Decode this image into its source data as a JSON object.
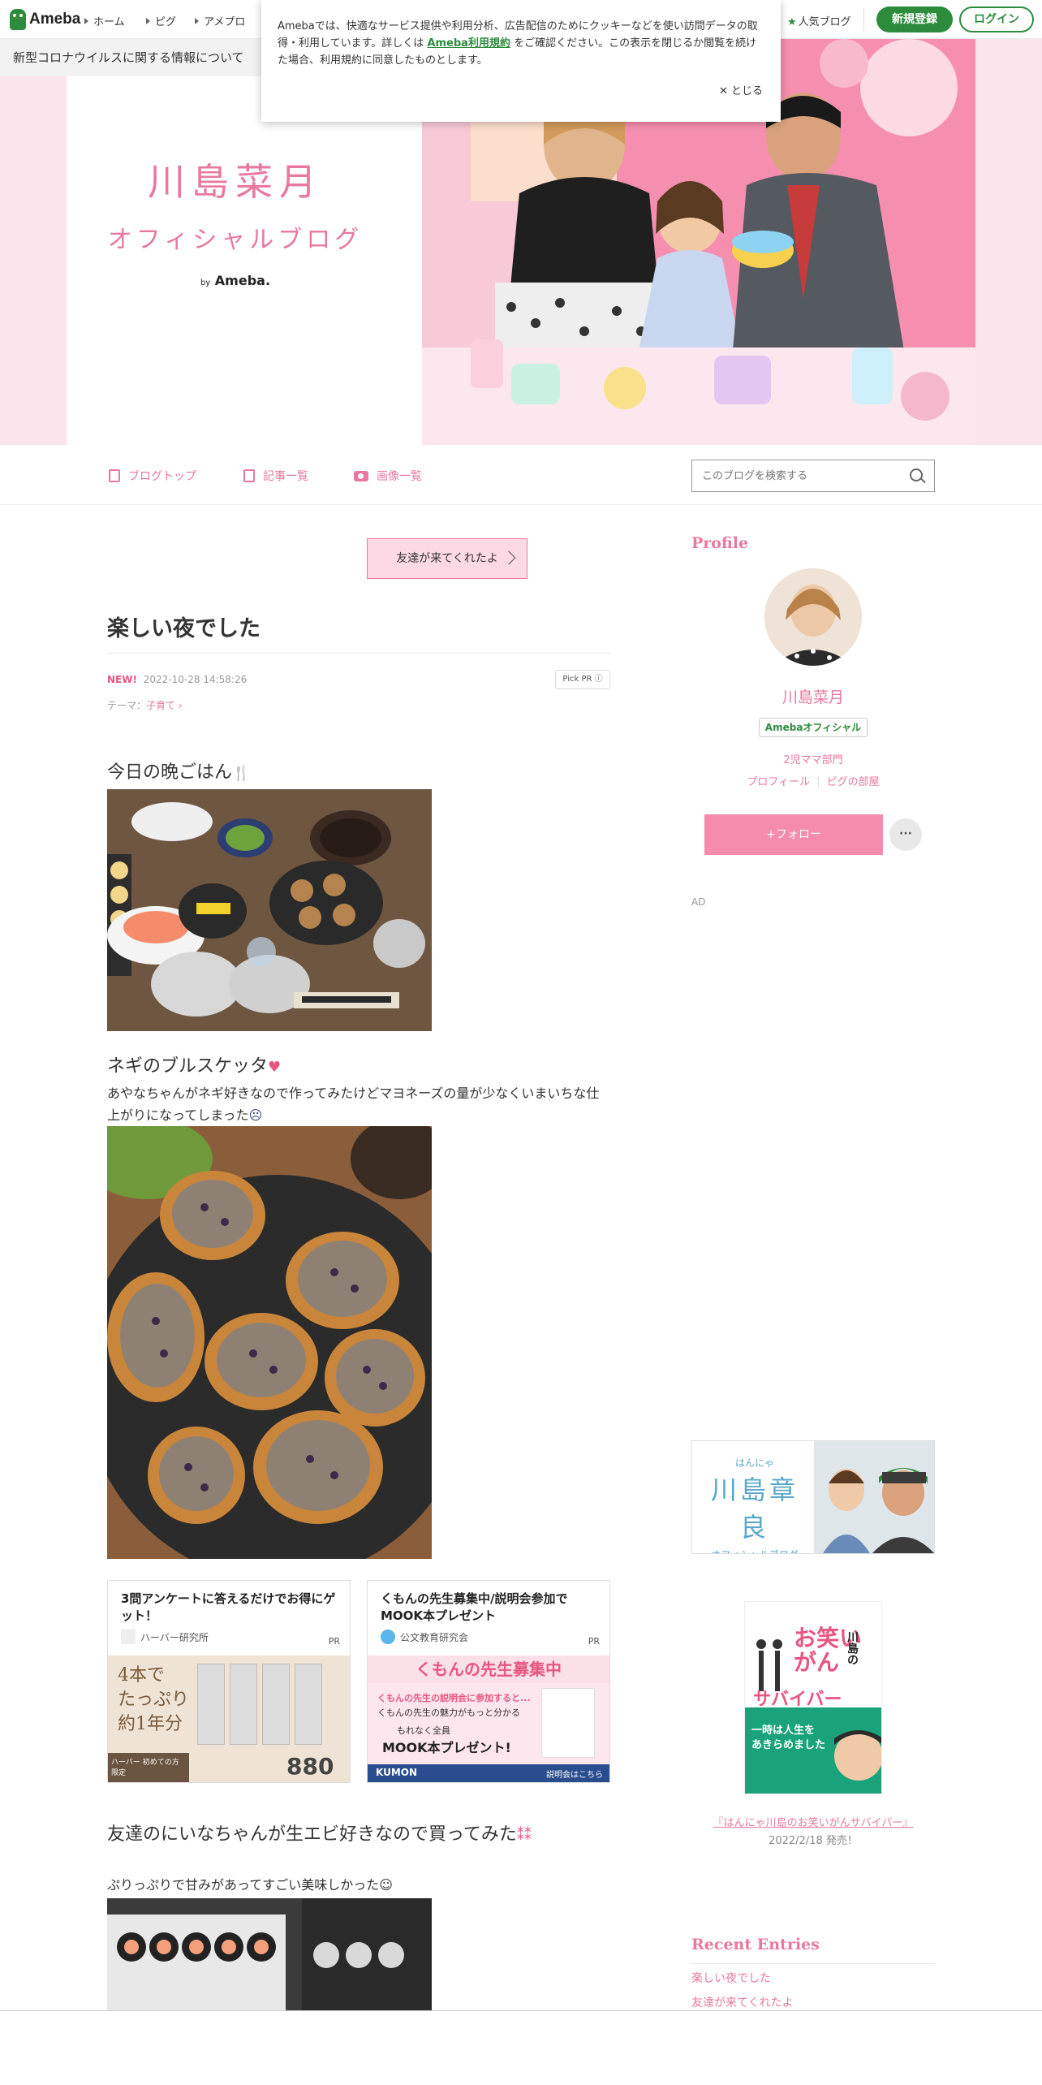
{
  "topbar": {
    "logo": "Ameba",
    "nav": [
      "ホーム",
      "ピグ",
      "アメプロ"
    ],
    "popular": "人気ブログ",
    "signup": "新規登録",
    "login": "ログイン"
  },
  "covid_banner": "新型コロナウイルスに関する情報について",
  "cookie": {
    "text_before": "Amebaでは、快適なサービス提供や利用分析、広告配信のためにクッキーなどを使い訪問データの取得・利用しています。詳しくは",
    "link": "Ameba利用規約",
    "text_after": "をご確認ください。この表示を閉じるか閲覧を続けた場合、利用規約に同意したものとします。",
    "close": "とじる"
  },
  "header": {
    "title_line1": "川島菜月",
    "title_line2": "オフィシャルブログ",
    "by": "by",
    "by_brand": "Ameba."
  },
  "blog_nav": {
    "items": [
      "ブログトップ",
      "記事一覧",
      "画像一覧"
    ],
    "search_placeholder": "このブログを検索する"
  },
  "entry": {
    "prev_button": "友達が来てくれたよ",
    "title": "楽しい夜でした",
    "new_badge": "NEW!",
    "date": "2022-10-28 14:58:26",
    "pick_pr": "Pick PR ⓘ",
    "theme_label": "テーマ：",
    "theme": "子育て",
    "p1": "今日の晩ごはん",
    "p2": "ネギのブルスケッタ",
    "p3": "あやなちゃんがネギ好きなので作ってみたけどマヨネーズの量が少なくいまいちな仕上がりになってしまった",
    "p4": "友達のにいなちゃんが生エビ好きなので買ってみた",
    "p5": "ぷりっぷりで甘みがあってすごい美味しかった"
  },
  "ads": [
    {
      "title": "3問アンケートに答えるだけでお得にゲット！",
      "source": "ハーバー研究所",
      "pr": "PR",
      "img_text1": "4本で",
      "img_text2": "たっぷり",
      "img_text3": "約1年分",
      "img_small": "ハーバー 初めての方限定",
      "price": "880円"
    },
    {
      "title": "くもんの先生募集中/説明会参加でMOOK本プレゼント",
      "source": "公文教育研究会",
      "pr": "PR",
      "img_head": "くもんの先生募集中",
      "img_l1": "くもんの先生の説明会に参加すると...",
      "img_l2": "くもんの先生の魅力がもっと分かる",
      "img_l3": "もれなく全員",
      "img_l4": "MOOK本プレゼント!",
      "img_brand": "KUMON",
      "img_cta": "説明会はこちら"
    }
  ],
  "sidebar": {
    "profile_heading": "Profile",
    "name": "川島菜月",
    "official": "Amebaオフィシャル",
    "desc": "2児ママ部門",
    "link1": "プロフィール",
    "link2": "ピグの部屋",
    "follow": "+フォロー",
    "more": "···",
    "ad_label": "AD",
    "banner_top": "はんにゃ",
    "banner_name": "川島章良",
    "banner_sub": "オフィシャルブログ",
    "book_title_l1": "お笑い",
    "book_title_l2": "がん",
    "book_title_l3": "サバイバー",
    "book_author": "川島の",
    "book_band1": "一時は人生を",
    "book_band2": "あきらめました",
    "book_link": "『はんにゃ川島のお笑いがんサバイバー』",
    "book_date": "2022/2/18 発売！",
    "recent_heading": "Recent Entries",
    "recent": [
      "楽しい夜でした",
      "友達が来てくれたよ"
    ]
  },
  "colors": {
    "ameba_green": "#2d8c3c",
    "blog_pink": "#e8789f",
    "header_band": "#f9e6ec"
  }
}
